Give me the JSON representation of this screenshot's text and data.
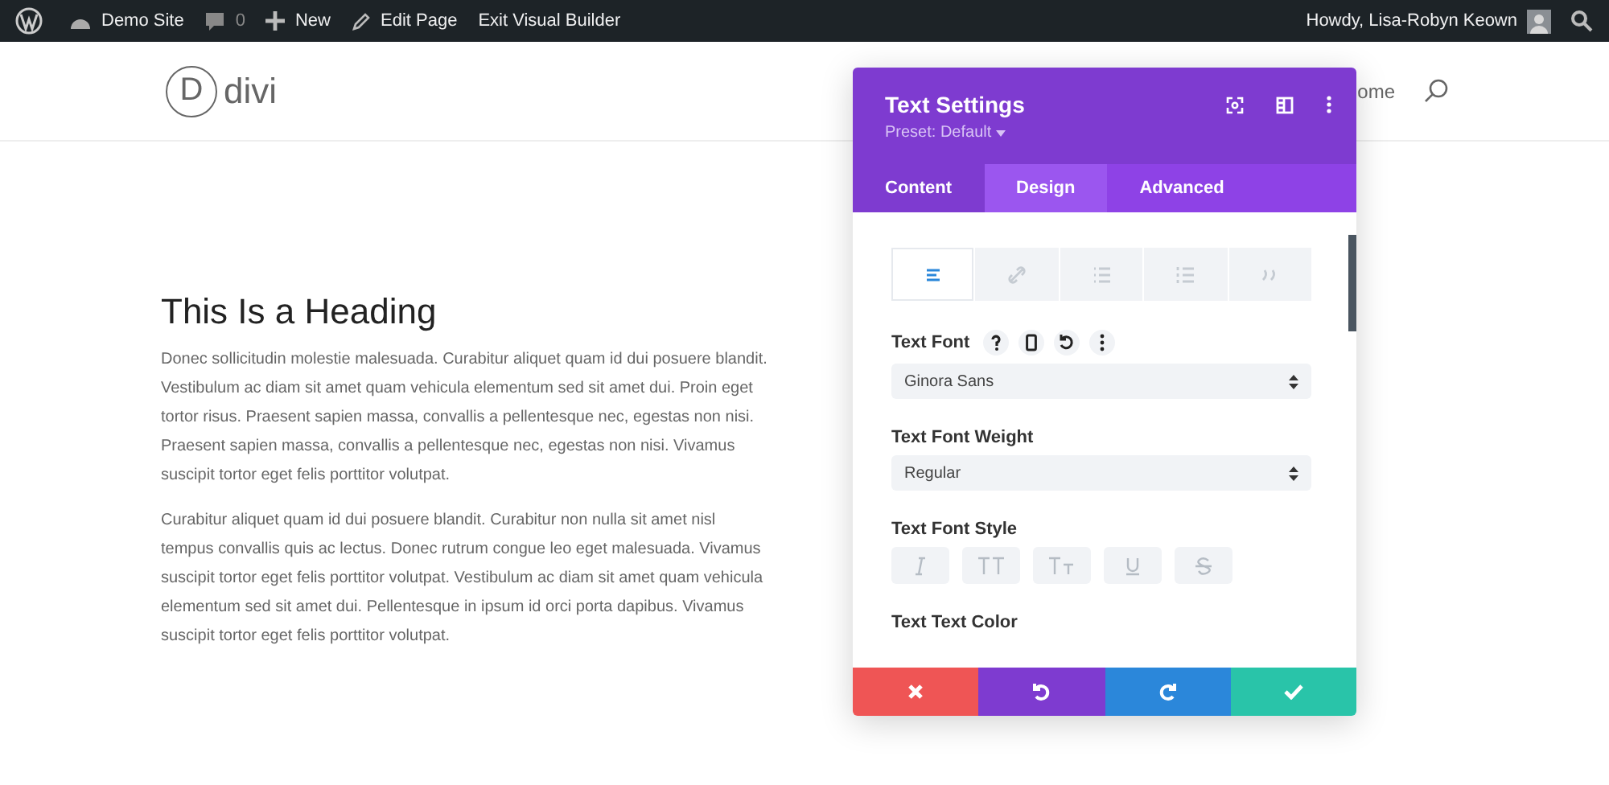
{
  "admin_bar": {
    "site": "Demo Site",
    "comments": "0",
    "new": "New",
    "edit": "Edit Page",
    "exit": "Exit Visual Builder",
    "greeting": "Howdy, Lisa-Robyn Keown"
  },
  "header": {
    "logo_letter": "D",
    "logo_text": "divi",
    "nav": [
      "ome"
    ]
  },
  "content": {
    "heading": "This Is a Heading",
    "paragraphs": [
      "Donec sollicitudin molestie malesuada. Curabitur aliquet quam id dui posuere blandit. Vestibulum ac diam sit amet quam vehicula elementum sed sit amet dui. Proin eget tortor risus. Praesent sapien massa, convallis a pellentesque nec, egestas non nisi. Praesent sapien massa, convallis a pellentesque nec, egestas non nisi. Vivamus suscipit tortor eget felis porttitor volutpat.",
      "Curabitur aliquet quam id dui posuere blandit. Curabitur non nulla sit amet nisl tempus convallis quis ac lectus. Donec rutrum congue leo eget malesuada. Vivamus suscipit tortor eget felis porttitor volutpat. Vestibulum ac diam sit amet quam vehicula elementum sed sit amet dui. Pellentesque in ipsum id orci porta dapibus. Vivamus suscipit tortor eget felis porttitor volutpat."
    ]
  },
  "modal": {
    "title": "Text Settings",
    "preset": "Preset: Default",
    "tabs": [
      {
        "label": "Content",
        "selected": false
      },
      {
        "label": "Design",
        "selected": true
      },
      {
        "label": "Advanced",
        "selected": false
      }
    ],
    "text_types": [
      {
        "kind": "paragraph",
        "selected": true
      },
      {
        "kind": "link",
        "selected": false
      },
      {
        "kind": "list",
        "selected": false
      },
      {
        "kind": "ordered-list",
        "selected": false
      },
      {
        "kind": "quote",
        "selected": false
      }
    ],
    "fields": [
      {
        "kind": "select",
        "label": "Text Font",
        "value": "Ginora Sans",
        "tools": true
      },
      {
        "kind": "select",
        "label": "Text Font Weight",
        "value": "Regular",
        "tools": false
      },
      {
        "kind": "styles",
        "label": "Text Font Style",
        "options": [
          {
            "kind": "italic",
            "selected": false
          },
          {
            "kind": "uppercase",
            "selected": false
          },
          {
            "kind": "smallcaps",
            "selected": false
          },
          {
            "kind": "underline",
            "selected": false
          },
          {
            "kind": "strike",
            "selected": false
          }
        ]
      },
      {
        "kind": "color",
        "label": "Text Text Color"
      }
    ]
  }
}
